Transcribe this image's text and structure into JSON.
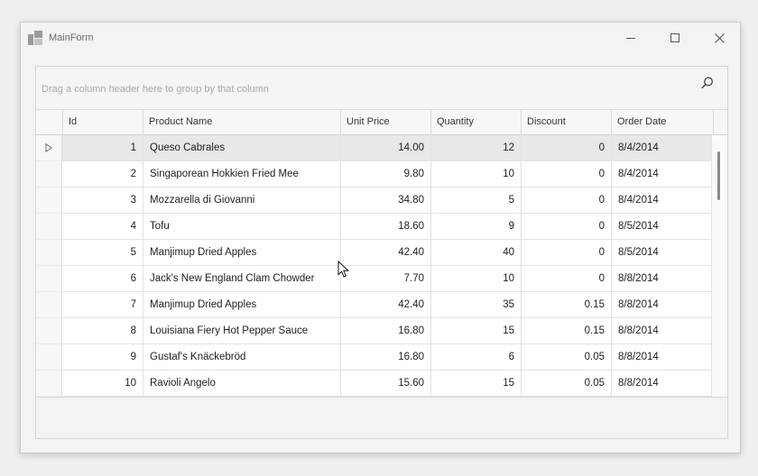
{
  "window": {
    "title": "MainForm"
  },
  "titlebar_icons": {
    "app": "app-icon",
    "minimize": "minimize-icon",
    "maximize": "maximize-icon",
    "close": "close-icon"
  },
  "grid": {
    "group_panel_text": "Drag a column header here to group by that column",
    "search_icon": "search-icon",
    "columns": [
      "Id",
      "Product Name",
      "Unit Price",
      "Quantity",
      "Discount",
      "Order Date"
    ],
    "focused_row_index": 0,
    "rows": [
      {
        "id": "1",
        "product": "Queso Cabrales",
        "price": "14.00",
        "quantity": "12",
        "discount": "0",
        "date": "8/4/2014"
      },
      {
        "id": "2",
        "product": "Singaporean Hokkien Fried Mee",
        "price": "9.80",
        "quantity": "10",
        "discount": "0",
        "date": "8/4/2014"
      },
      {
        "id": "3",
        "product": "Mozzarella di Giovanni",
        "price": "34.80",
        "quantity": "5",
        "discount": "0",
        "date": "8/4/2014"
      },
      {
        "id": "4",
        "product": "Tofu",
        "price": "18.60",
        "quantity": "9",
        "discount": "0",
        "date": "8/5/2014"
      },
      {
        "id": "5",
        "product": "Manjimup Dried Apples",
        "price": "42.40",
        "quantity": "40",
        "discount": "0",
        "date": "8/5/2014"
      },
      {
        "id": "6",
        "product": "Jack's New England Clam Chowder",
        "price": "7.70",
        "quantity": "10",
        "discount": "0",
        "date": "8/8/2014"
      },
      {
        "id": "7",
        "product": "Manjimup Dried Apples",
        "price": "42.40",
        "quantity": "35",
        "discount": "0.15",
        "date": "8/8/2014"
      },
      {
        "id": "8",
        "product": "Louisiana Fiery Hot Pepper Sauce",
        "price": "16.80",
        "quantity": "15",
        "discount": "0.15",
        "date": "8/8/2014"
      },
      {
        "id": "9",
        "product": "Gustaf's Knäckebröd",
        "price": "16.80",
        "quantity": "6",
        "discount": "0.05",
        "date": "8/8/2014"
      },
      {
        "id": "10",
        "product": "Ravioli Angelo",
        "price": "15.60",
        "quantity": "15",
        "discount": "0.05",
        "date": "8/8/2014"
      }
    ]
  },
  "colors": {
    "focused_row": "#e8e8e8",
    "grid_line": "#e3e3e3",
    "scroll_thumb": "#8a8a8a"
  }
}
